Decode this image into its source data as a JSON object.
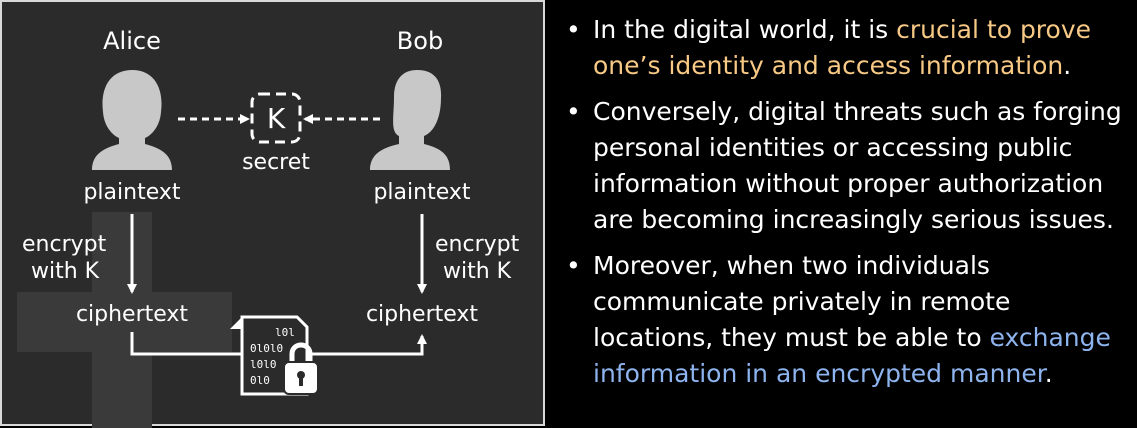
{
  "diagram": {
    "alice": "Alice",
    "bob": "Bob",
    "key_letter": "K",
    "secret": "secret",
    "plaintext_left": "plaintext",
    "plaintext_right": "plaintext",
    "encrypt_left": [
      "encrypt",
      "with K"
    ],
    "encrypt_right": [
      "encrypt",
      "with K"
    ],
    "ciphertext_left": "ciphertext",
    "ciphertext_right": "ciphertext",
    "binary_lines": [
      "l0l",
      "0l0l0",
      "l0l0",
      "0l0"
    ],
    "icons": [
      "person-icon",
      "key-box-icon",
      "encrypted-document-icon",
      "padlock-icon"
    ],
    "colors": {
      "panel": "#2b2b2b",
      "border": "#d9d9d9",
      "person": "#c8c8c8"
    }
  },
  "bullets": [
    {
      "segments": [
        {
          "text": "In the digital world, it is ",
          "hl": ""
        },
        {
          "text": "crucial to prove one’s identity and access information",
          "hl": "orange"
        },
        {
          "text": ".",
          "hl": ""
        }
      ]
    },
    {
      "segments": [
        {
          "text": "Conversely, digital threats such as forging personal identities or accessing public information without proper authorization are becoming increasingly serious issues.",
          "hl": ""
        }
      ]
    },
    {
      "segments": [
        {
          "text": "Moreover, when two individuals communicate privately in remote locations, they must be able to ",
          "hl": ""
        },
        {
          "text": "exchange information in an encrypted manner",
          "hl": "blue"
        },
        {
          "text": ".",
          "hl": ""
        }
      ]
    }
  ],
  "highlight_colors": {
    "orange": "#f7c985",
    "blue": "#8db4ee"
  }
}
